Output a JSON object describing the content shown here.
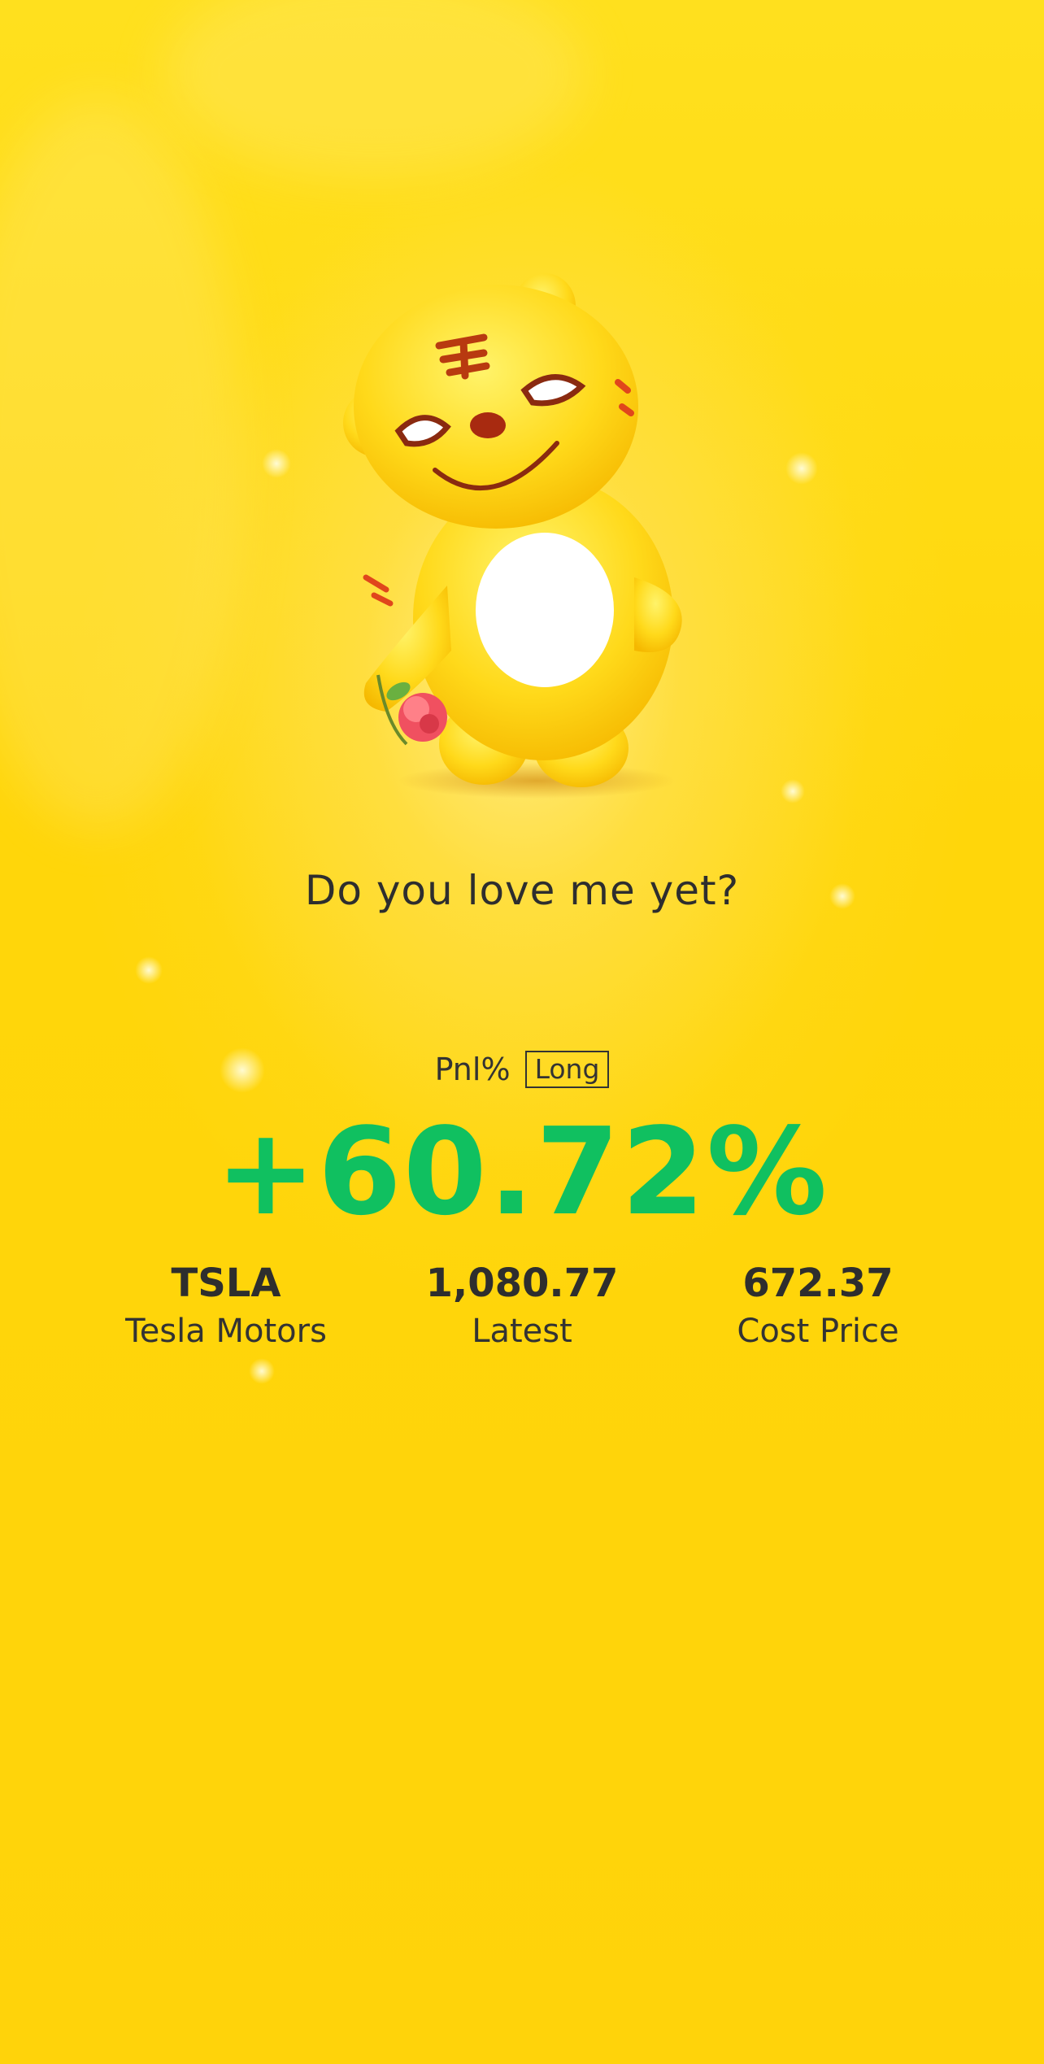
{
  "title": "Do you love me yet?",
  "pnl": {
    "label": "Pnl%",
    "badge": "Long",
    "value": "+60.72%"
  },
  "stats": [
    {
      "value": "TSLA",
      "label": "Tesla Motors"
    },
    {
      "value": "1,080.77",
      "label": "Latest"
    },
    {
      "value": "672.37",
      "label": "Cost Price"
    }
  ],
  "colors": {
    "background": "#FFD60A",
    "positive": "#10C060",
    "text": "#2E2E2E"
  },
  "icons": {
    "mascot": "tiger-mascot-with-flower"
  }
}
